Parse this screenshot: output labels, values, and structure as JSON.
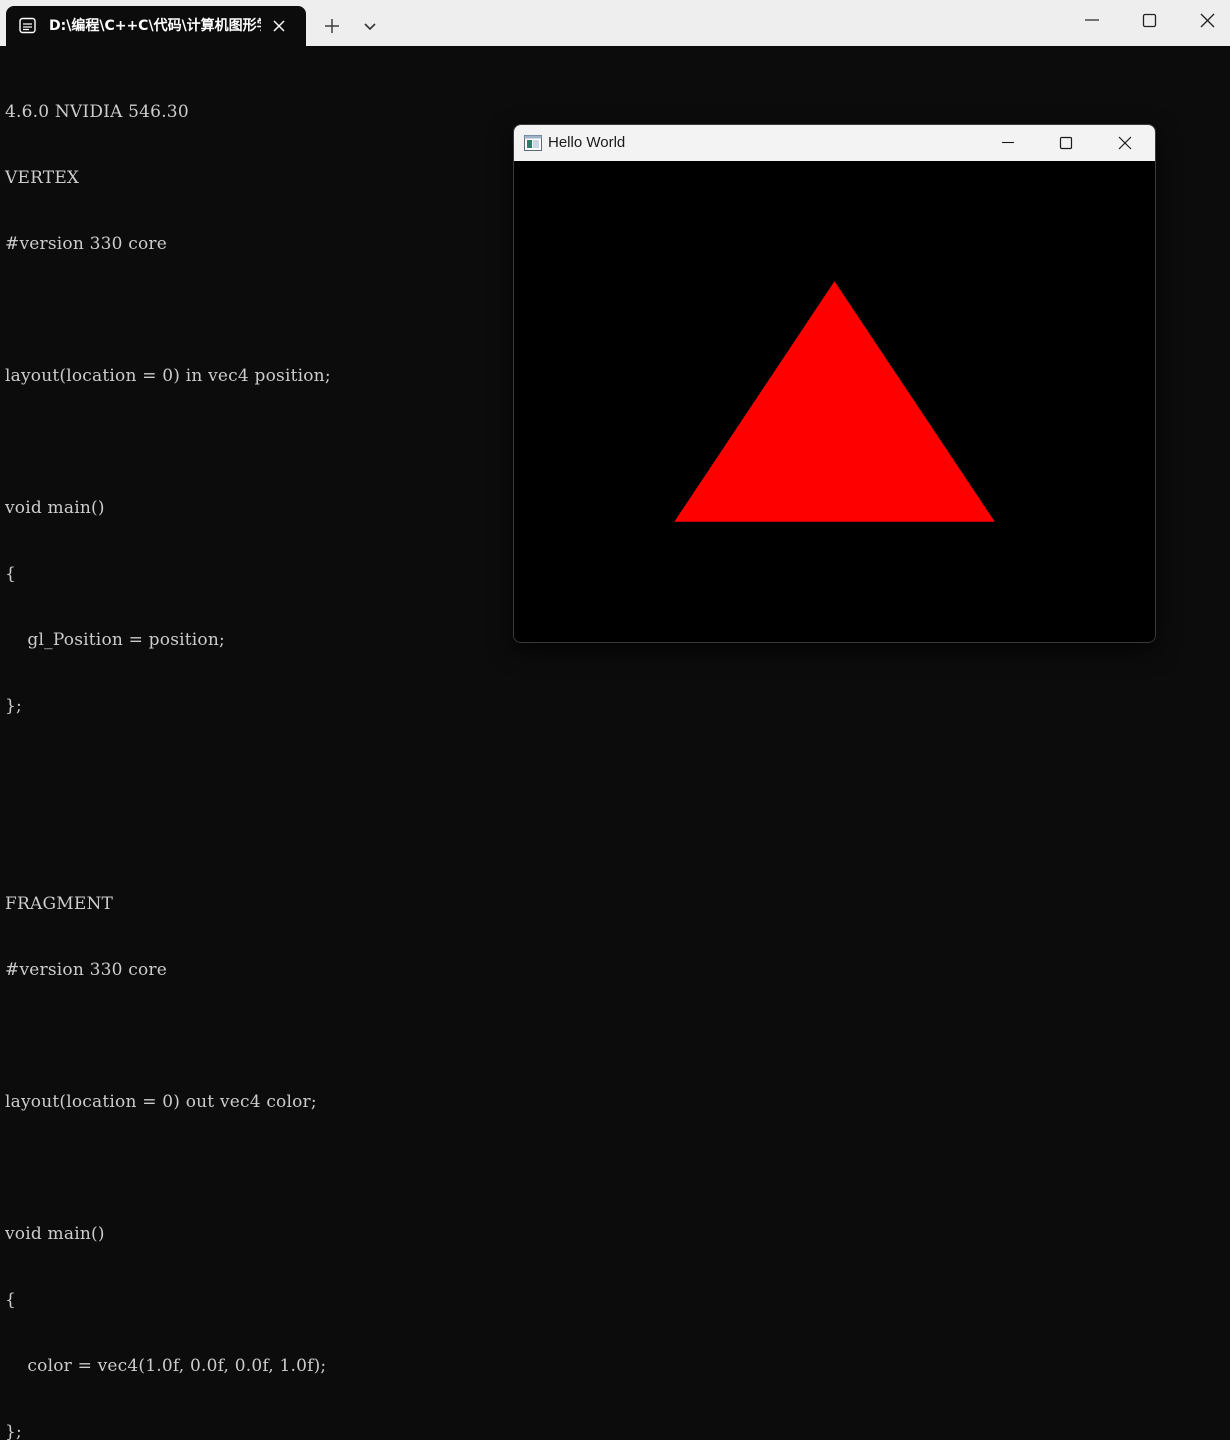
{
  "terminal_window": {
    "tab_title": "D:\\编程\\C++C\\代码\\计算机图形学",
    "tab_icon": "terminal-icon",
    "close_icon": "close-icon",
    "new_tab_icon": "plus-icon",
    "dropdown_icon": "chevron-down-icon",
    "window_controls": [
      "minimize-icon",
      "maximize-icon",
      "close-icon"
    ],
    "titlebar_color": "#eeeeee",
    "background_color": "#0c0c0c",
    "text_color": "#cccccc"
  },
  "output": {
    "lines": [
      "4.6.0 NVIDIA 546.30",
      "VERTEX",
      "#version 330 core",
      "",
      "layout(location = 0) in vec4 position;",
      "",
      "void main()",
      "{",
      "    gl_Position = position;",
      "};",
      "",
      "",
      "FRAGMENT",
      "#version 330 core",
      "",
      "layout(location = 0) out vec4 color;",
      "",
      "void main()",
      "{",
      "    color = vec4(1.0f, 0.0f, 0.0f, 1.0f);",
      "};"
    ]
  },
  "gl_window": {
    "title": "Hello World",
    "app_icon": "window-app-icon",
    "window_controls": [
      "minimize-icon",
      "maximize-icon",
      "close-icon"
    ],
    "canvas_color": "#000000",
    "triangle": {
      "color": "#ff0000",
      "vertices": [
        [
          -0.5,
          -0.5
        ],
        [
          0.0,
          0.5
        ],
        [
          0.5,
          -0.5
        ]
      ]
    }
  }
}
